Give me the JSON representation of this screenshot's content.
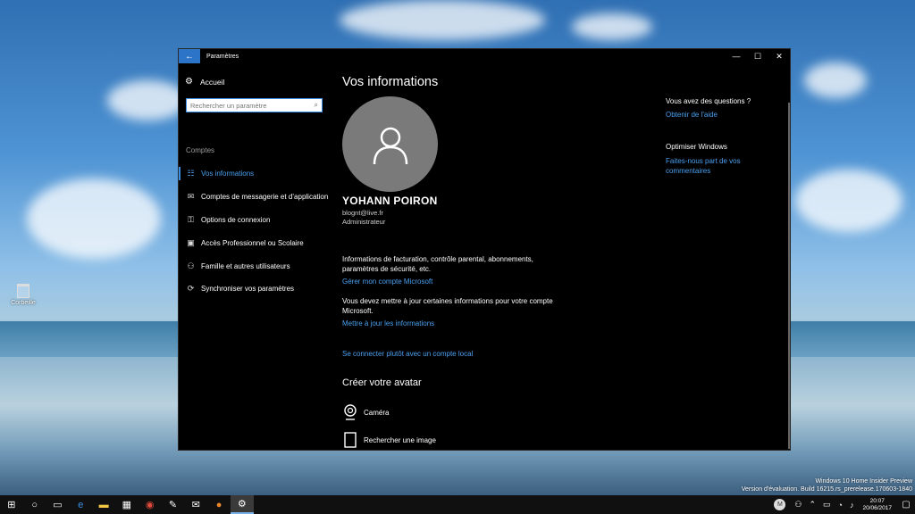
{
  "desktop": {
    "recycle_bin_label": "Corbeille"
  },
  "window": {
    "title": "Paramètres",
    "back_glyph": "←",
    "minimize_glyph": "—",
    "maximize_glyph": "☐",
    "close_glyph": "✕"
  },
  "sidebar": {
    "home_label": "Accueil",
    "search_placeholder": "Rechercher un paramètre",
    "section_label": "Comptes",
    "items": [
      {
        "label": "Vos informations",
        "icon": "person-card-icon",
        "active": true
      },
      {
        "label": "Comptes de messagerie et d’application",
        "icon": "mail-icon",
        "active": false
      },
      {
        "label": "Options de connexion",
        "icon": "key-icon",
        "active": false
      },
      {
        "label": "Accès Professionnel ou Scolaire",
        "icon": "briefcase-icon",
        "active": false
      },
      {
        "label": "Famille et autres utilisateurs",
        "icon": "family-icon",
        "active": false
      },
      {
        "label": "Synchroniser vos paramètres",
        "icon": "sync-icon",
        "active": false
      }
    ]
  },
  "content": {
    "heading": "Vos informations",
    "user_name": "YOHANN POIRON",
    "email": "blognt@live.fr",
    "role": "Administrateur",
    "billing_text": "Informations de facturation, contrôle parental, abonnements, paramètres de sécurité, etc.",
    "manage_link": "Gérer mon compte Microsoft",
    "update_text": "Vous devez mettre à jour certaines informations pour votre compte Microsoft.",
    "update_link": "Mettre à jour les informations",
    "local_link": "Se connecter plutôt avec un compte local",
    "avatar_heading": "Créer votre avatar",
    "camera_label": "Caméra",
    "browse_label": "Rechercher une image"
  },
  "right_panel": {
    "questions_heading": "Vous avez des questions ?",
    "help_link": "Obtenir de l'aide",
    "improve_heading": "Optimiser Windows",
    "feedback_link": "Faites-nous part de vos commentaires"
  },
  "watermark": {
    "line1": "Windows 10 Home Insider Preview",
    "line2": "Version d'évaluation. Build 16215.rs_prerelease.170603-1840"
  },
  "taskbar": {
    "icons": [
      "start-icon",
      "cortana-icon",
      "task-view-icon",
      "edge-icon",
      "file-explorer-icon",
      "store-icon",
      "chrome-icon",
      "paint-icon",
      "mail-icon",
      "firefox-icon",
      "settings-icon"
    ],
    "avatar_letter": "M",
    "time": "20:07",
    "date": "20/06/2017"
  },
  "colors": {
    "accent": "#2b74c8",
    "link": "#4aa0f0",
    "window_bg": "#000000"
  }
}
